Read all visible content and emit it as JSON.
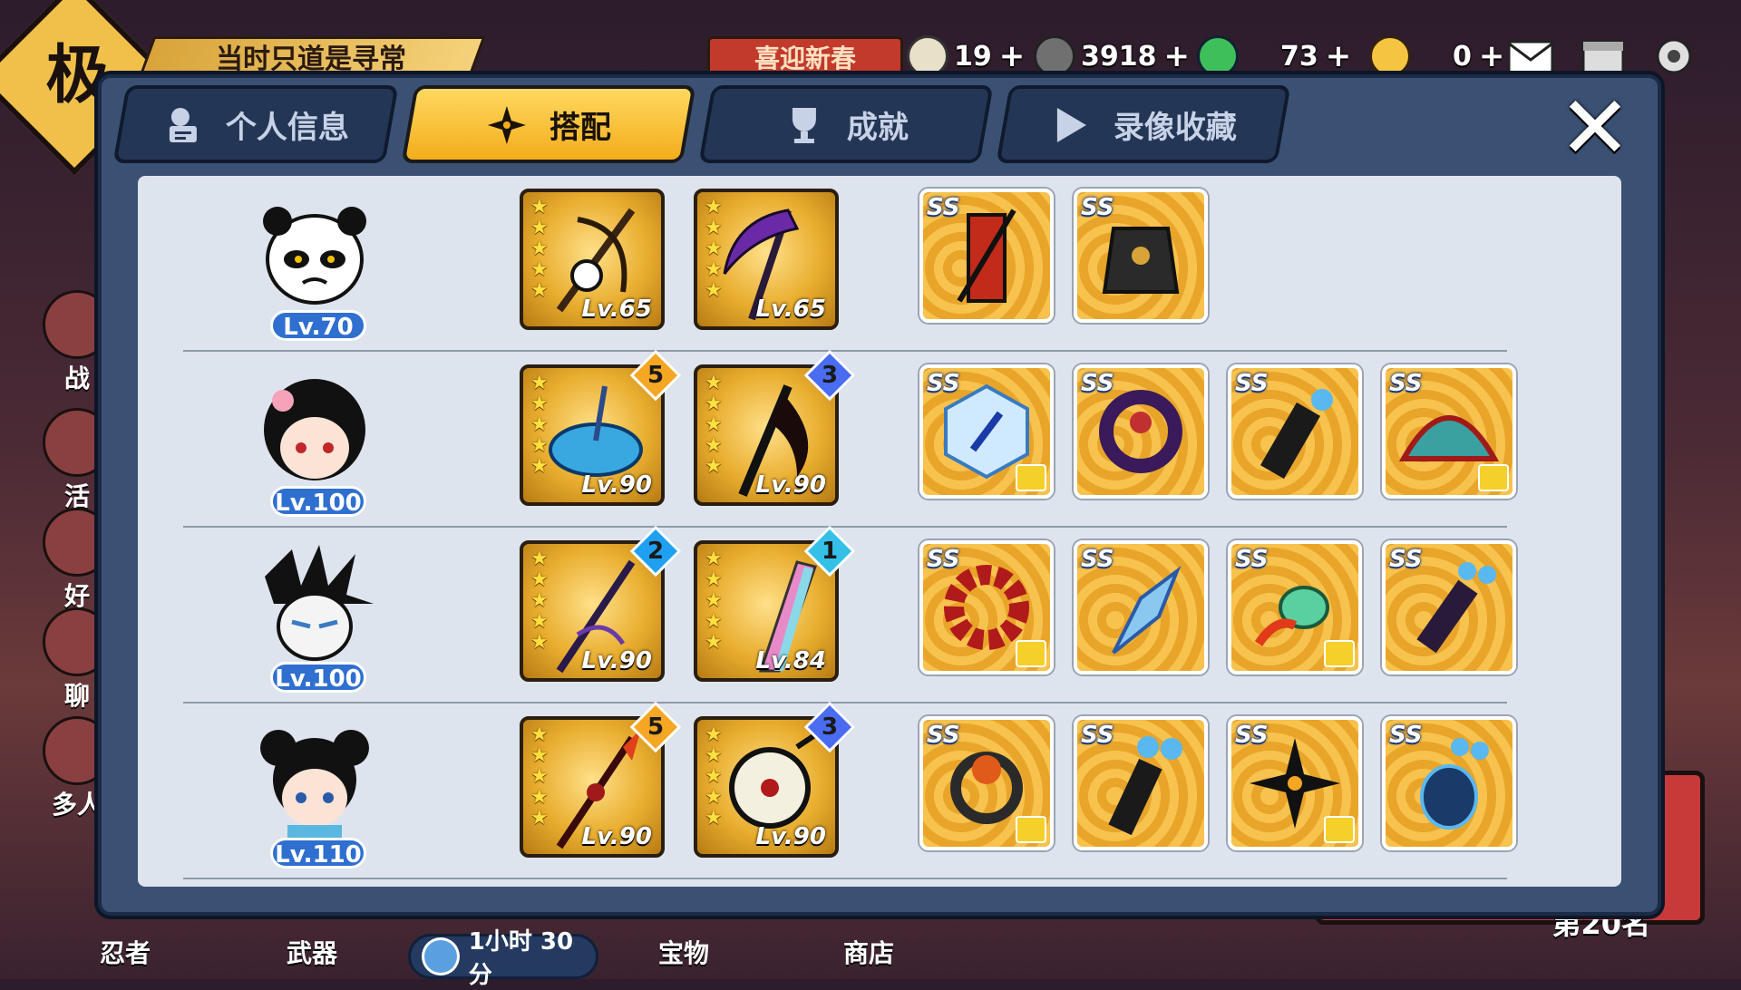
{
  "hud": {
    "corner_badge": "极",
    "banner_text": "当时只道是寻常",
    "red_banner_text": "喜迎新春",
    "resources": [
      {
        "icon": "bun-icon",
        "value": "19",
        "color": "#ffffff"
      },
      {
        "icon": "coin-icon",
        "value": "3918",
        "color": "#ffffff"
      },
      {
        "icon": "green-gem-icon",
        "value": "73",
        "color": "#3fbf5a"
      },
      {
        "icon": "gold-key-icon",
        "value": "0",
        "color": "#f5c542"
      }
    ],
    "plus": "+"
  },
  "side_menu": [
    {
      "label": "战"
    },
    {
      "label": "活"
    },
    {
      "label": "好"
    },
    {
      "label": "聊"
    },
    {
      "label": "多人"
    }
  ],
  "bottom_menu": [
    {
      "label": "忍者"
    },
    {
      "label": "武器"
    },
    {
      "label": "宝物"
    },
    {
      "label": "商店"
    }
  ],
  "timer": "1小时 30分",
  "rank_text": "第20名",
  "dialog": {
    "tabs": [
      {
        "label": "个人信息",
        "icon": "profile-icon",
        "active": false
      },
      {
        "label": "搭配",
        "icon": "shuriken-icon",
        "active": true
      },
      {
        "label": "成就",
        "icon": "trophy-icon",
        "active": false
      },
      {
        "label": "录像收藏",
        "icon": "play-icon",
        "active": false
      }
    ],
    "close_label": "✕",
    "rows": [
      {
        "ninja": {
          "name": "panda-ninja",
          "level": "Lv.70"
        },
        "weapons": [
          {
            "level": "Lv.65",
            "stars": 5,
            "rank": null
          },
          {
            "level": "Lv.65",
            "stars": 5,
            "rank": null
          }
        ],
        "treasures": [
          {
            "grade": "SS",
            "has_shirt": false
          },
          {
            "grade": "SS",
            "has_shirt": false
          }
        ]
      },
      {
        "ninja": {
          "name": "black-hair-girl-ninja",
          "level": "Lv.100"
        },
        "weapons": [
          {
            "level": "Lv.90",
            "stars": 5,
            "rank": "5",
            "rank_color": "#f5a623"
          },
          {
            "level": "Lv.90",
            "stars": 5,
            "rank": "3",
            "rank_color": "#4a6cf0"
          }
        ],
        "treasures": [
          {
            "grade": "SS",
            "has_shirt": true
          },
          {
            "grade": "SS",
            "has_shirt": false
          },
          {
            "grade": "SS",
            "has_shirt": false
          },
          {
            "grade": "SS",
            "has_shirt": true
          }
        ]
      },
      {
        "ninja": {
          "name": "spiky-masked-ninja",
          "level": "Lv.100"
        },
        "weapons": [
          {
            "level": "Lv.90",
            "stars": 5,
            "rank": "2",
            "rank_color": "#1fa0f0"
          },
          {
            "level": "Lv.84",
            "stars": 5,
            "rank": "1",
            "rank_color": "#35c0e8"
          }
        ],
        "treasures": [
          {
            "grade": "SS",
            "has_shirt": true
          },
          {
            "grade": "SS",
            "has_shirt": false
          },
          {
            "grade": "SS",
            "has_shirt": true
          },
          {
            "grade": "SS",
            "has_shirt": false
          }
        ]
      },
      {
        "ninja": {
          "name": "bun-hair-girl-ninja",
          "level": "Lv.110"
        },
        "weapons": [
          {
            "level": "Lv.90",
            "stars": 5,
            "rank": "5",
            "rank_color": "#f5a623"
          },
          {
            "level": "Lv.90",
            "stars": 5,
            "rank": "3",
            "rank_color": "#4a6cf0"
          }
        ],
        "treasures": [
          {
            "grade": "SS",
            "has_shirt": true
          },
          {
            "grade": "SS",
            "has_shirt": false
          },
          {
            "grade": "SS",
            "has_shirt": true
          },
          {
            "grade": "SS",
            "has_shirt": false
          }
        ]
      }
    ]
  }
}
